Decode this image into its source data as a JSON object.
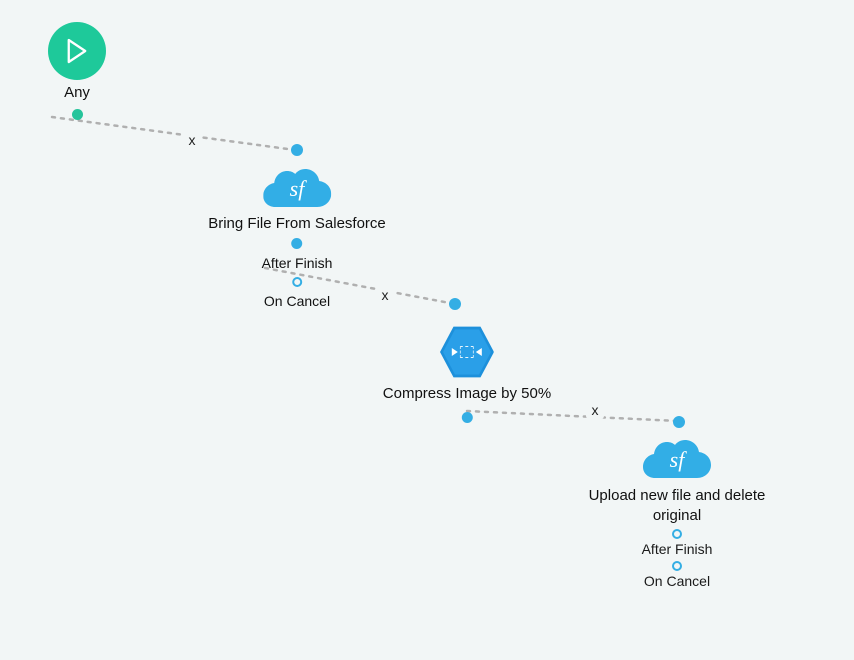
{
  "colors": {
    "bg": "#f2f6f6",
    "teal": "#1ec99a",
    "blue": "#2a9fe8",
    "blueDark": "#1d90db",
    "dash": "#b0b0b0"
  },
  "nodes": {
    "start": {
      "label": "Any",
      "port": "filled-teal",
      "icon": "play-icon"
    },
    "fetch": {
      "label": "Bring File From Salesforce",
      "icon": "salesforce-cloud",
      "iconText": "sf",
      "ports": [
        {
          "label": "After Finish",
          "state": "filled-blue"
        },
        {
          "label": "On Cancel",
          "state": "open-blue"
        }
      ]
    },
    "compress": {
      "label": "Compress Image by 50%",
      "icon": "compress-hex",
      "outPort": "filled-blue"
    },
    "upload": {
      "label": "Upload new file and delete original",
      "icon": "salesforce-cloud",
      "iconText": "sf",
      "ports": [
        {
          "label": "After Finish",
          "state": "open-blue"
        },
        {
          "label": "On Cancel",
          "state": "open-blue"
        }
      ]
    }
  },
  "edges": [
    {
      "from": "start",
      "to": "fetch",
      "removeGlyph": "x"
    },
    {
      "from": "fetch",
      "to": "compress",
      "removeGlyph": "x"
    },
    {
      "from": "compress",
      "to": "upload",
      "removeGlyph": "x"
    }
  ]
}
